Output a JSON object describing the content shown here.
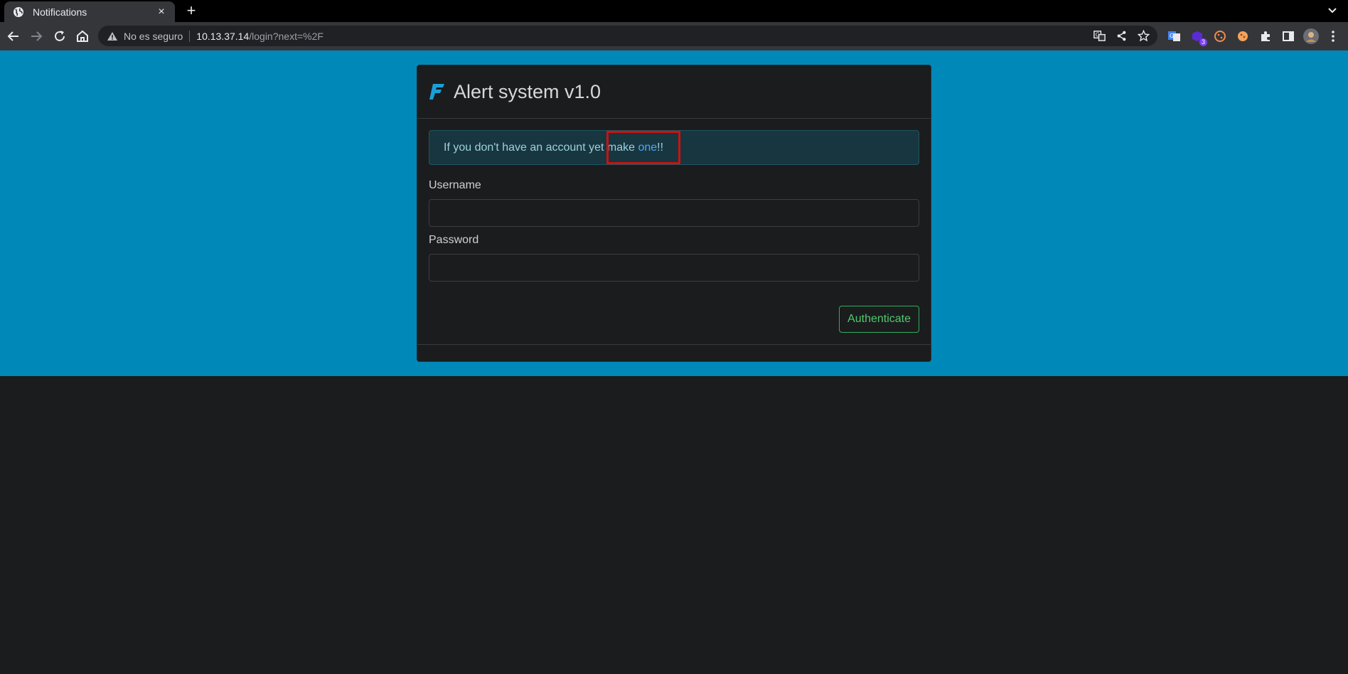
{
  "browser": {
    "tab_title": "Notifications",
    "tab_close": "×",
    "new_tab": "+",
    "security_label": "No es seguro",
    "url_host": "10.13.37.14",
    "url_path": "/login?next=%2F",
    "extension_badge": "3"
  },
  "page": {
    "title": "Alert system v1.0",
    "alert": {
      "text_before": "If you don't have an account yet make ",
      "link": "one",
      "text_after": "!!"
    },
    "form": {
      "username_label": "Username",
      "username_value": "",
      "password_label": "Password",
      "password_value": "",
      "submit_label": "Authenticate"
    }
  },
  "colors": {
    "hero_bg": "#0088b8",
    "page_bg": "#1b1c1e",
    "link": "#4aa6ff",
    "success": "#4fc96f",
    "highlight": "#d01010"
  }
}
